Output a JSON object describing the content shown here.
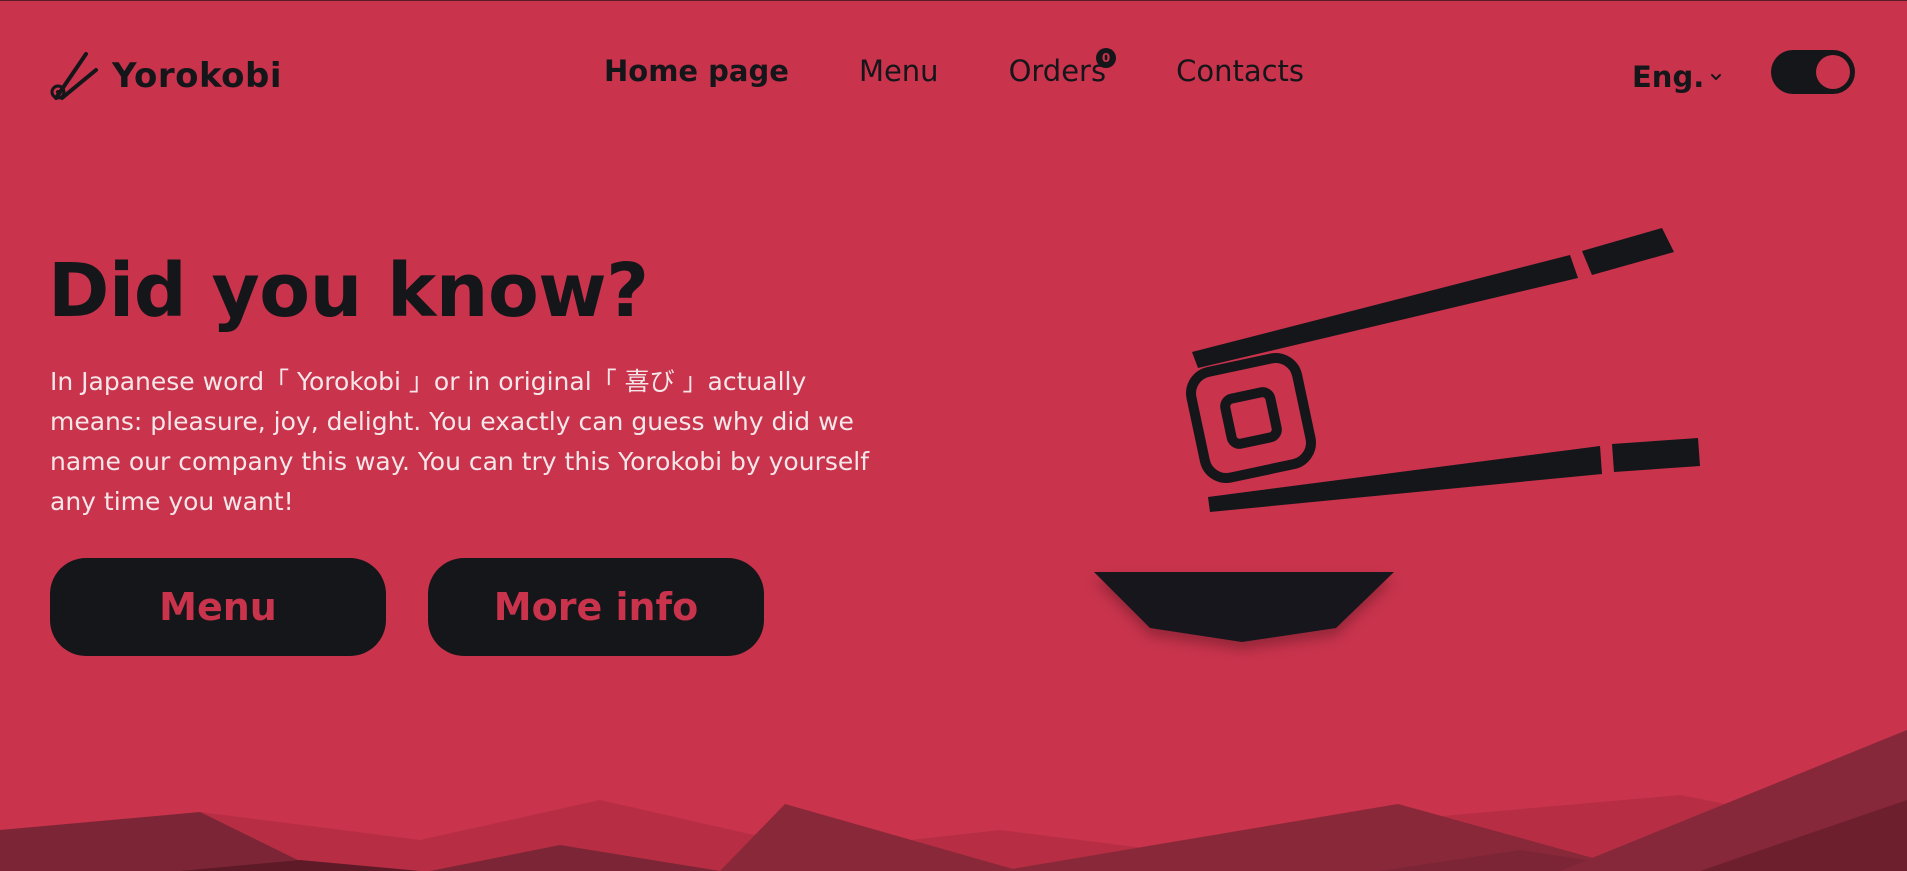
{
  "brand": {
    "name": "Yorokobi"
  },
  "nav": {
    "items": [
      {
        "label": "Home page",
        "active": true
      },
      {
        "label": "Menu"
      },
      {
        "label": "Orders",
        "badge": "0"
      },
      {
        "label": "Contacts"
      }
    ]
  },
  "language": {
    "selected": "Eng."
  },
  "theme_toggle": {
    "state": "on"
  },
  "hero": {
    "title": "Did you know?",
    "text": "In Japanese word「 Yorokobi 」or in original「 喜び 」actually means: pleasure, joy, delight. You exactly can guess why did we name our company this way. You can try this Yorokobi by yourself any time you want!",
    "buttons": {
      "menu": "Menu",
      "more_info": "More info"
    }
  },
  "colors": {
    "background": "#c9334c",
    "dark": "#14161a",
    "light_text": "#f4e6e9"
  },
  "icons": [
    "chopsticks-logo-icon",
    "chevron-down-icon",
    "sushi-chopsticks-illustration",
    "bowl-icon"
  ]
}
